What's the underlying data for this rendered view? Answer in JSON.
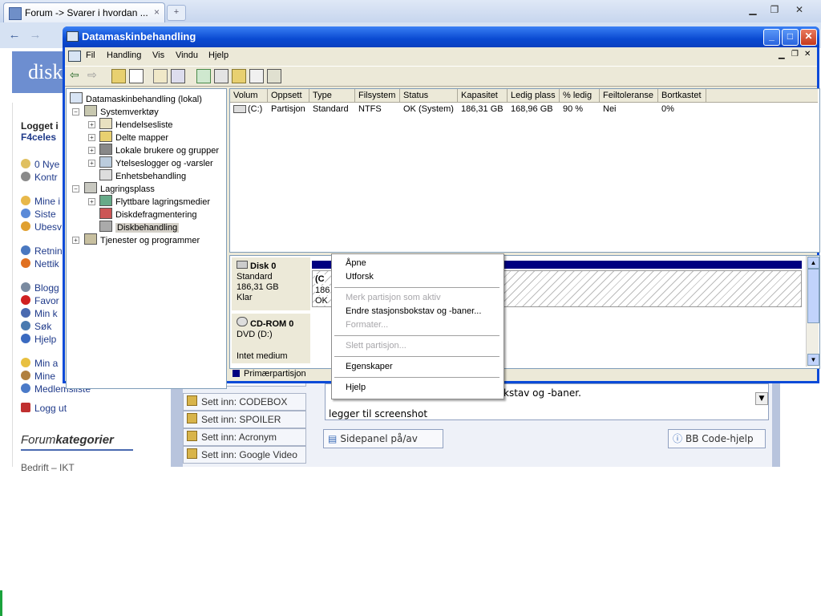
{
  "browser": {
    "tab_title": "Forum -> Svarer i hvordan ...",
    "tab_close": "×",
    "newtab": "+",
    "nav_back": "←",
    "nav_forward": "→"
  },
  "forum": {
    "logo_text": "disk",
    "logged_in_partial": "Logget i",
    "user_partial": "F4celes",
    "sidebar": [
      {
        "label": "0 Nye",
        "color": "#e0c060"
      },
      {
        "label": "Kontr",
        "color": "#8a8a8a"
      },
      {
        "label": "Mine i",
        "color": "#e8b84a"
      },
      {
        "label": "Siste",
        "color": "#5a8ad8"
      },
      {
        "label": "Ubesv",
        "color": "#e0a030"
      },
      {
        "label": "Retnin",
        "color": "#4a78c0"
      },
      {
        "label": "Nettik",
        "color": "#e07020"
      },
      {
        "label": "Blogg",
        "color": "#7a8aa0"
      },
      {
        "label": "Favor",
        "color": "#d02020"
      },
      {
        "label": "Min k",
        "color": "#4a6ab0"
      },
      {
        "label": "Søk",
        "color": "#4a7ab0"
      },
      {
        "label": "Hjelp",
        "color": "#3a6ac0"
      },
      {
        "label": "Min a",
        "color": "#e8c040"
      },
      {
        "label": "Mine",
        "color": "#b08040"
      },
      {
        "label": "Medlemsliste",
        "color": "#4a7ac8"
      }
    ],
    "logout": "Logg ut",
    "categories_title_1": "Forum",
    "categories_title_2": "kategorier",
    "bottom_partial": "Bedrift – IKT",
    "insert_buttons": [
      "Sett inn: CODEBOX",
      "Sett inn: SPOILER",
      "Sett inn: Acronym",
      "Sett inn: Google Video"
    ],
    "editor_line1": "kstav og -baner.",
    "editor_line2": "legger til screenshot",
    "sidepanel_btn": "Sidepanel på/av",
    "bbcode_btn": "BB Code-hjelp"
  },
  "mmc": {
    "title": "Datamaskinbehandling",
    "menus": [
      "Fil",
      "Handling",
      "Vis",
      "Vindu",
      "Hjelp"
    ],
    "tree": {
      "root": "Datamaskinbehandling (lokal)",
      "systemverktoy": "Systemverktøy",
      "hendelsesliste": "Hendelsesliste",
      "delte_mapper": "Delte mapper",
      "lokale_brukere": "Lokale brukere og grupper",
      "ytelseslogger": "Ytelseslogger og -varsler",
      "enhetsbehandling": "Enhetsbehandling",
      "lagringsplass": "Lagringsplass",
      "flyttbare": "Flyttbare lagringsmedier",
      "diskdefrag": "Diskdefragmentering",
      "diskbehandling": "Diskbehandling",
      "tjenester": "Tjenester og programmer"
    },
    "columns": [
      "Volum",
      "Oppsett",
      "Type",
      "Filsystem",
      "Status",
      "Kapasitet",
      "Ledig plass",
      "% ledig",
      "Feiltoleranse",
      "Bortkastet"
    ],
    "row": [
      "(C:)",
      "Partisjon",
      "Standard",
      "NTFS",
      "OK (System)",
      "186,31 GB",
      "168,96 GB",
      "90 %",
      "Nei",
      "0%"
    ],
    "disk0": {
      "name": "Disk 0",
      "type": "Standard",
      "size": "186,31 GB",
      "status": "Klar"
    },
    "partition": {
      "label": "(C",
      "size": "186",
      "status": "OK"
    },
    "cdrom": {
      "name": "CD-ROM 0",
      "type": "DVD (D:)",
      "media": "Intet medium"
    },
    "legend": "Primærpartisjon",
    "colors": {
      "primary_partition": "#000080",
      "title_bar": "#0a4ad2"
    }
  },
  "context_menu": {
    "items": [
      {
        "label": "Åpne",
        "enabled": true
      },
      {
        "label": "Utforsk",
        "enabled": true
      },
      {
        "label": "Merk partisjon som aktiv",
        "enabled": false
      },
      {
        "label": "Endre stasjonsbokstav og -baner...",
        "enabled": true
      },
      {
        "label": "Formater...",
        "enabled": false
      },
      {
        "label": "Slett partisjon...",
        "enabled": false
      },
      {
        "label": "Egenskaper",
        "enabled": true
      },
      {
        "label": "Hjelp",
        "enabled": true
      }
    ]
  }
}
